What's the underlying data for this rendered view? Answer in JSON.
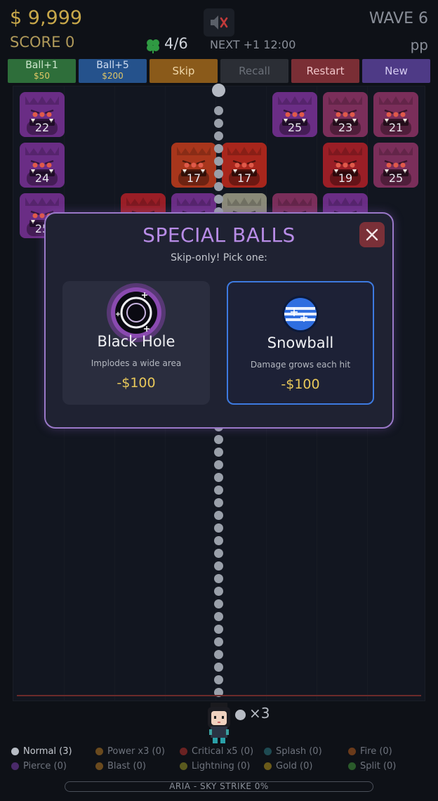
{
  "hud": {
    "money": "$ 9,999",
    "score": "SCORE 0",
    "wave": "WAVE 6",
    "player": "pp",
    "lives": "4/6",
    "next": "NEXT +1 12:00"
  },
  "toolbar": [
    {
      "label": "Ball+1",
      "price": "$50",
      "bg": "#2e6e3a",
      "fg": "#cfe8cf"
    },
    {
      "label": "Ball+5",
      "price": "$200",
      "bg": "#25528c",
      "fg": "#cfdcf0"
    },
    {
      "label": "Skip",
      "price": "",
      "bg": "#8a5a1a",
      "fg": "#f0d7a8"
    },
    {
      "label": "Recall",
      "price": "",
      "bg": "#2b2e35",
      "fg": "#6b7079"
    },
    {
      "label": "Restart",
      "price": "",
      "bg": "#7a2e35",
      "fg": "#f0c4c8"
    },
    {
      "label": "New",
      "price": "",
      "bg": "#4e3a86",
      "fg": "#d6ccf2"
    }
  ],
  "blocks": [
    {
      "hp": "22",
      "color": "#6a2d85"
    },
    {
      "hp": "25",
      "color": "#6a2d85"
    },
    {
      "hp": "23",
      "color": "#7a2e5a"
    },
    {
      "hp": "21",
      "color": "#7a2e5a"
    },
    {
      "hp": "24",
      "color": "#6a2d85"
    },
    {
      "hp": "17",
      "color": "#a8361c"
    },
    {
      "hp": "17",
      "color": "#a8261c"
    },
    {
      "hp": "19",
      "color": "#9a1e26"
    },
    {
      "hp": "25",
      "color": "#7a2e5a"
    },
    {
      "hp": "25",
      "color": "#6a2d85"
    },
    {
      "hp": "",
      "color": "#9a1e26"
    },
    {
      "hp": "",
      "color": "#6a2d85"
    },
    {
      "hp": "",
      "color": "#8a8a78"
    },
    {
      "hp": "",
      "color": "#7a2e5a"
    },
    {
      "hp": "",
      "color": "#6a2d85"
    }
  ],
  "launcher": {
    "ball_count": "×3"
  },
  "legend": [
    {
      "label": "Normal (3)",
      "color": "#b7bcc4",
      "active": true
    },
    {
      "label": "Power x3 (0)",
      "color": "#6a4a1e"
    },
    {
      "label": "Critical x5 (0)",
      "color": "#6a2222"
    },
    {
      "label": "Splash (0)",
      "color": "#1e4a52"
    },
    {
      "label": "Fire (0)",
      "color": "#6a3a1a"
    },
    {
      "label": "Pierce (0)",
      "color": "#4a2a6a"
    },
    {
      "label": "Blast (0)",
      "color": "#6a4a1e"
    },
    {
      "label": "Lightning (0)",
      "color": "#5a5a1e"
    },
    {
      "label": "Gold (0)",
      "color": "#6a5a1a"
    },
    {
      "label": "Split (0)",
      "color": "#2a5a2a"
    }
  ],
  "status": "ARIA  -  SKY STRIKE   0%",
  "modal": {
    "title": "SPECIAL BALLS",
    "subtitle": "Skip-only! Pick one:",
    "options": [
      {
        "name": "Black Hole",
        "desc": "Implodes a wide area",
        "price": "-$100",
        "icon": "black-hole-icon"
      },
      {
        "name": "Snowball",
        "desc": "Damage grows each hit",
        "price": "-$100",
        "icon": "snowball-icon"
      }
    ]
  }
}
